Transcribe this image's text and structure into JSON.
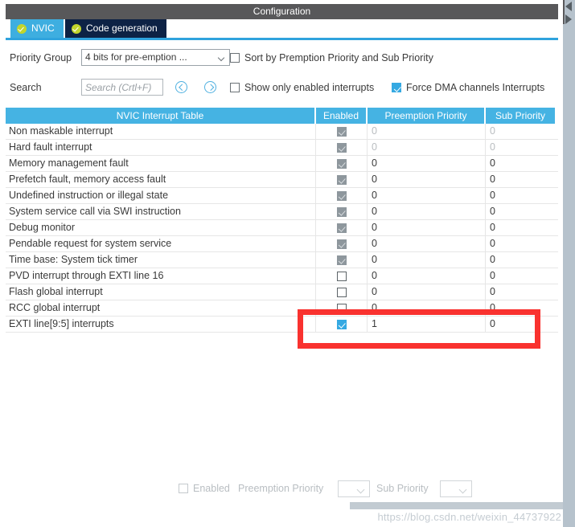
{
  "window": {
    "title": "Configuration"
  },
  "tabs": [
    {
      "label": "NVIC",
      "icon": "check-circle-icon",
      "active": true
    },
    {
      "label": "Code generation",
      "icon": "check-circle-icon",
      "active": false
    }
  ],
  "controls": {
    "priority_group_label": "Priority Group",
    "priority_group_value": "4 bits for pre-emption ...",
    "sort_checkbox_label": "Sort by Premption Priority and Sub Priority",
    "sort_checkbox_checked": false,
    "search_label": "Search",
    "search_value": "",
    "search_placeholder": "Search (Crtl+F)",
    "prev_button": "previous-match-icon",
    "next_button": "next-match-icon",
    "show_enabled_label": "Show only enabled interrupts",
    "show_enabled_checked": false,
    "force_dma_label": "Force DMA channels Interrupts",
    "force_dma_checked": true
  },
  "table": {
    "columns": [
      "NVIC Interrupt Table",
      "Enabled",
      "Preemption Priority",
      "Sub Priority"
    ],
    "rows": [
      {
        "name": "Non maskable interrupt",
        "enabled": "locked",
        "preemption": "0",
        "sub": "0",
        "dim": true
      },
      {
        "name": "Hard fault interrupt",
        "enabled": "locked",
        "preemption": "0",
        "sub": "0",
        "dim": true
      },
      {
        "name": "Memory management fault",
        "enabled": "locked",
        "preemption": "0",
        "sub": "0",
        "dim": false
      },
      {
        "name": "Prefetch fault, memory access fault",
        "enabled": "locked",
        "preemption": "0",
        "sub": "0",
        "dim": false
      },
      {
        "name": "Undefined instruction or illegal state",
        "enabled": "locked",
        "preemption": "0",
        "sub": "0",
        "dim": false
      },
      {
        "name": "System service call via SWI instruction",
        "enabled": "locked",
        "preemption": "0",
        "sub": "0",
        "dim": false
      },
      {
        "name": "Debug monitor",
        "enabled": "locked",
        "preemption": "0",
        "sub": "0",
        "dim": false
      },
      {
        "name": "Pendable request for system service",
        "enabled": "locked",
        "preemption": "0",
        "sub": "0",
        "dim": false
      },
      {
        "name": "Time base: System tick timer",
        "enabled": "locked",
        "preemption": "0",
        "sub": "0",
        "dim": false
      },
      {
        "name": "PVD interrupt through EXTI line 16",
        "enabled": "unchecked",
        "preemption": "0",
        "sub": "0",
        "dim": false
      },
      {
        "name": "Flash global interrupt",
        "enabled": "unchecked",
        "preemption": "0",
        "sub": "0",
        "dim": false
      },
      {
        "name": "RCC global interrupt",
        "enabled": "unchecked",
        "preemption": "0",
        "sub": "0",
        "dim": false
      },
      {
        "name": "EXTI line[9:5] interrupts",
        "enabled": "checked",
        "preemption": "1",
        "sub": "0",
        "dim": false
      }
    ]
  },
  "highlight": {
    "color": "#f9322f",
    "covers_rows": [
      "RCC global interrupt",
      "EXTI line[9:5] interrupts"
    ]
  },
  "bottom": {
    "enabled_label": "Enabled",
    "enabled_checked": false,
    "preemption_label": "Preemption Priority",
    "preemption_value": "",
    "sub_label": "Sub Priority",
    "sub_value": "",
    "disabled": true
  },
  "watermark": {
    "text": "https://blog.csdn.net/weixin_44737922"
  },
  "colors": {
    "accent": "#45b3e3",
    "tab_active": "#3eaee0",
    "tab_inactive": "#0d2245",
    "titlebar": "#58585a",
    "highlight": "#f9322f"
  }
}
